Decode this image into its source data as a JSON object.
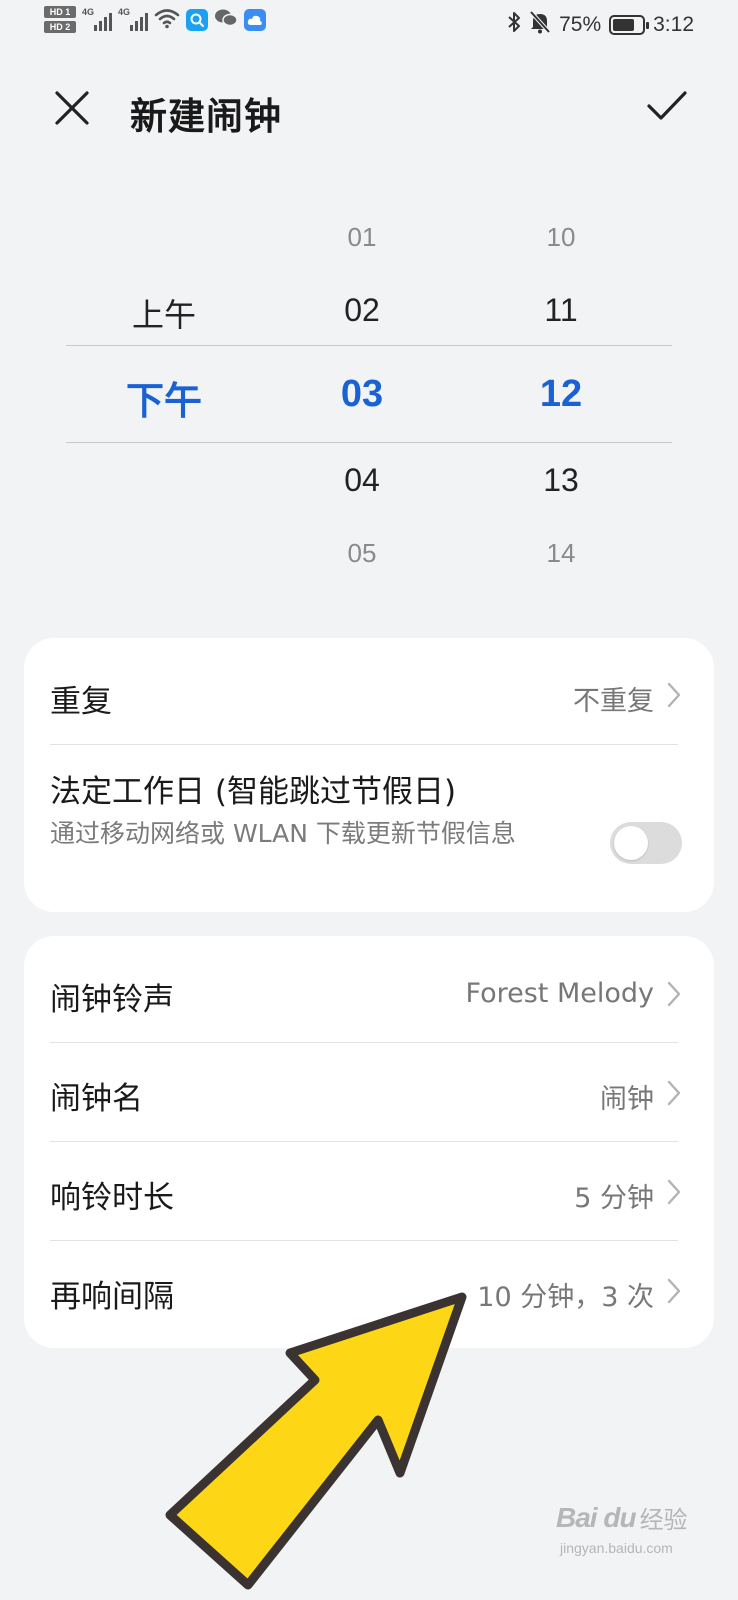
{
  "status_bar": {
    "sim1_badge": "HD 1",
    "sim2_badge": "HD 2",
    "network1": "4G",
    "network2": "4G",
    "battery_percent": "75%",
    "battery_level": 0.75,
    "time": "3:12"
  },
  "header": {
    "title": "新建闹钟",
    "close_icon": "close-icon",
    "confirm_icon": "check-icon"
  },
  "time_picker": {
    "ampm": {
      "above": "上午",
      "selected": "下午"
    },
    "hours": {
      "above2": "01",
      "above1": "02",
      "selected": "03",
      "below1": "04",
      "below2": "05"
    },
    "minutes": {
      "above2": "10",
      "above1": "11",
      "selected": "12",
      "below1": "13",
      "below2": "14"
    },
    "selected_color": "#1a62d4"
  },
  "card1": {
    "repeat": {
      "label": "重复",
      "value": "不重复"
    },
    "workday": {
      "label": "法定工作日 (智能跳过节假日)",
      "description": "通过移动网络或 WLAN 下载更新节假信息",
      "toggle_on": false
    }
  },
  "card2": {
    "items": [
      {
        "label": "闹钟铃声",
        "value": "Forest Melody"
      },
      {
        "label": "闹钟名",
        "value": "闹钟"
      },
      {
        "label": "响铃时长",
        "value": "5 分钟"
      },
      {
        "label": "再响间隔",
        "value": "10 分钟，3 次"
      }
    ]
  },
  "overlay": {
    "arrow_color": "#fdd716",
    "watermark_logo": "Bai du",
    "watermark_text": "经验",
    "watermark_url": "jingyan.baidu.com"
  }
}
